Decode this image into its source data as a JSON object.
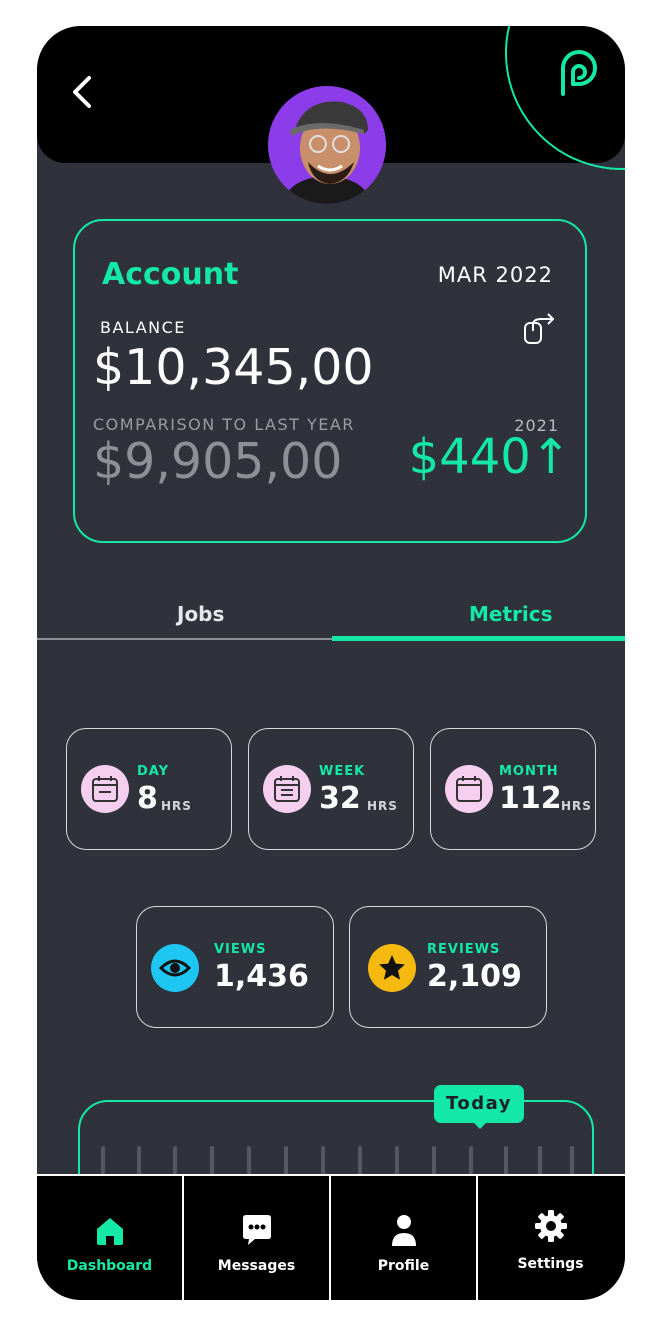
{
  "account": {
    "title": "Account",
    "date": "MAR 2022",
    "balance_label": "BALANCE",
    "balance": "$10,345,00",
    "comparison_label": "COMPARISON TO LAST YEAR",
    "comparison_value": "$9,905,00",
    "comparison_year": "2021",
    "delta": "$440↑"
  },
  "tabs": [
    {
      "label": "Jobs",
      "active": false
    },
    {
      "label": "Metrics",
      "active": true
    }
  ],
  "hours": [
    {
      "label": "DAY",
      "value": "8",
      "unit": "HRS"
    },
    {
      "label": "WEEK",
      "value": "32",
      "unit": "HRS"
    },
    {
      "label": "MONTH",
      "value": "112",
      "unit": "HRS"
    }
  ],
  "stats": [
    {
      "label": "VIEWS",
      "value": "1,436",
      "icon": "eye-icon",
      "color": "#1ec7f2"
    },
    {
      "label": "REVIEWS",
      "value": "2,109",
      "icon": "star-icon",
      "color": "#f5b90f"
    }
  ],
  "timeline": {
    "today_label": "Today"
  },
  "nav": [
    {
      "label": "Dashboard",
      "icon": "home-icon",
      "active": true
    },
    {
      "label": "Messages",
      "icon": "chat-icon",
      "active": false
    },
    {
      "label": "Profile",
      "icon": "user-icon",
      "active": false
    },
    {
      "label": "Settings",
      "icon": "gear-icon",
      "active": false
    }
  ],
  "colors": {
    "accent": "#14e8a6",
    "background": "#2f323b",
    "calendar_badge": "#f6cff0"
  }
}
